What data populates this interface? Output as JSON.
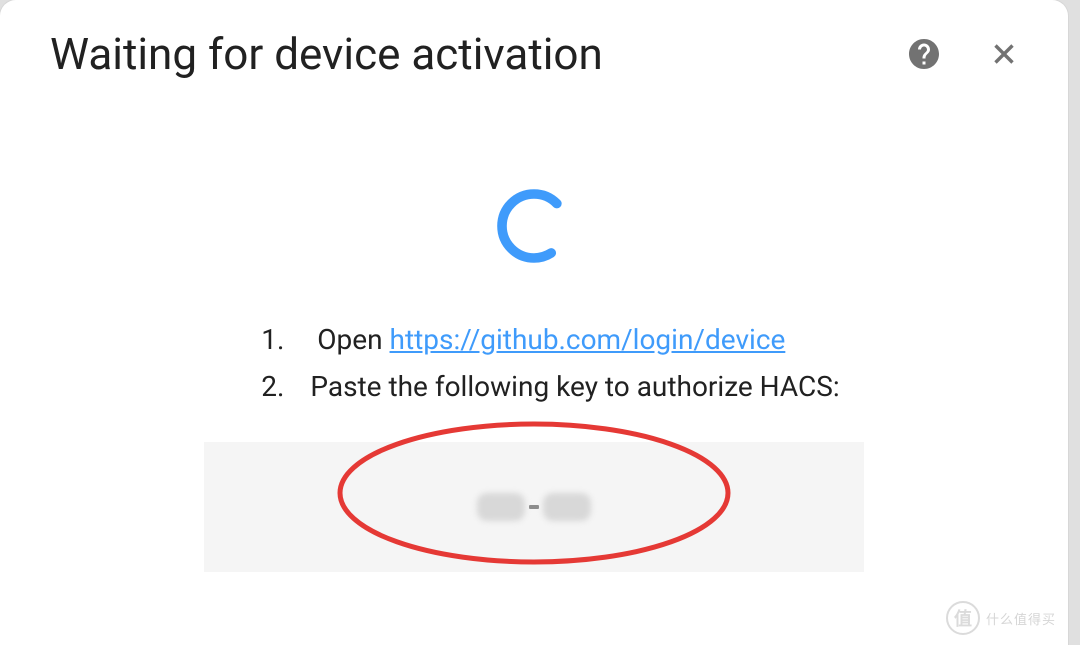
{
  "dialog": {
    "title": "Waiting for device activation",
    "instructions": {
      "step1_prefix": "Open ",
      "step1_link_text": "https://github.com/login/device",
      "step2": "Paste the following key to authorize HACS:"
    }
  },
  "watermark": {
    "icon_text": "值",
    "text": "什么值得买"
  },
  "colors": {
    "spinner": "#3f9bfb",
    "ellipse": "#e53935"
  }
}
